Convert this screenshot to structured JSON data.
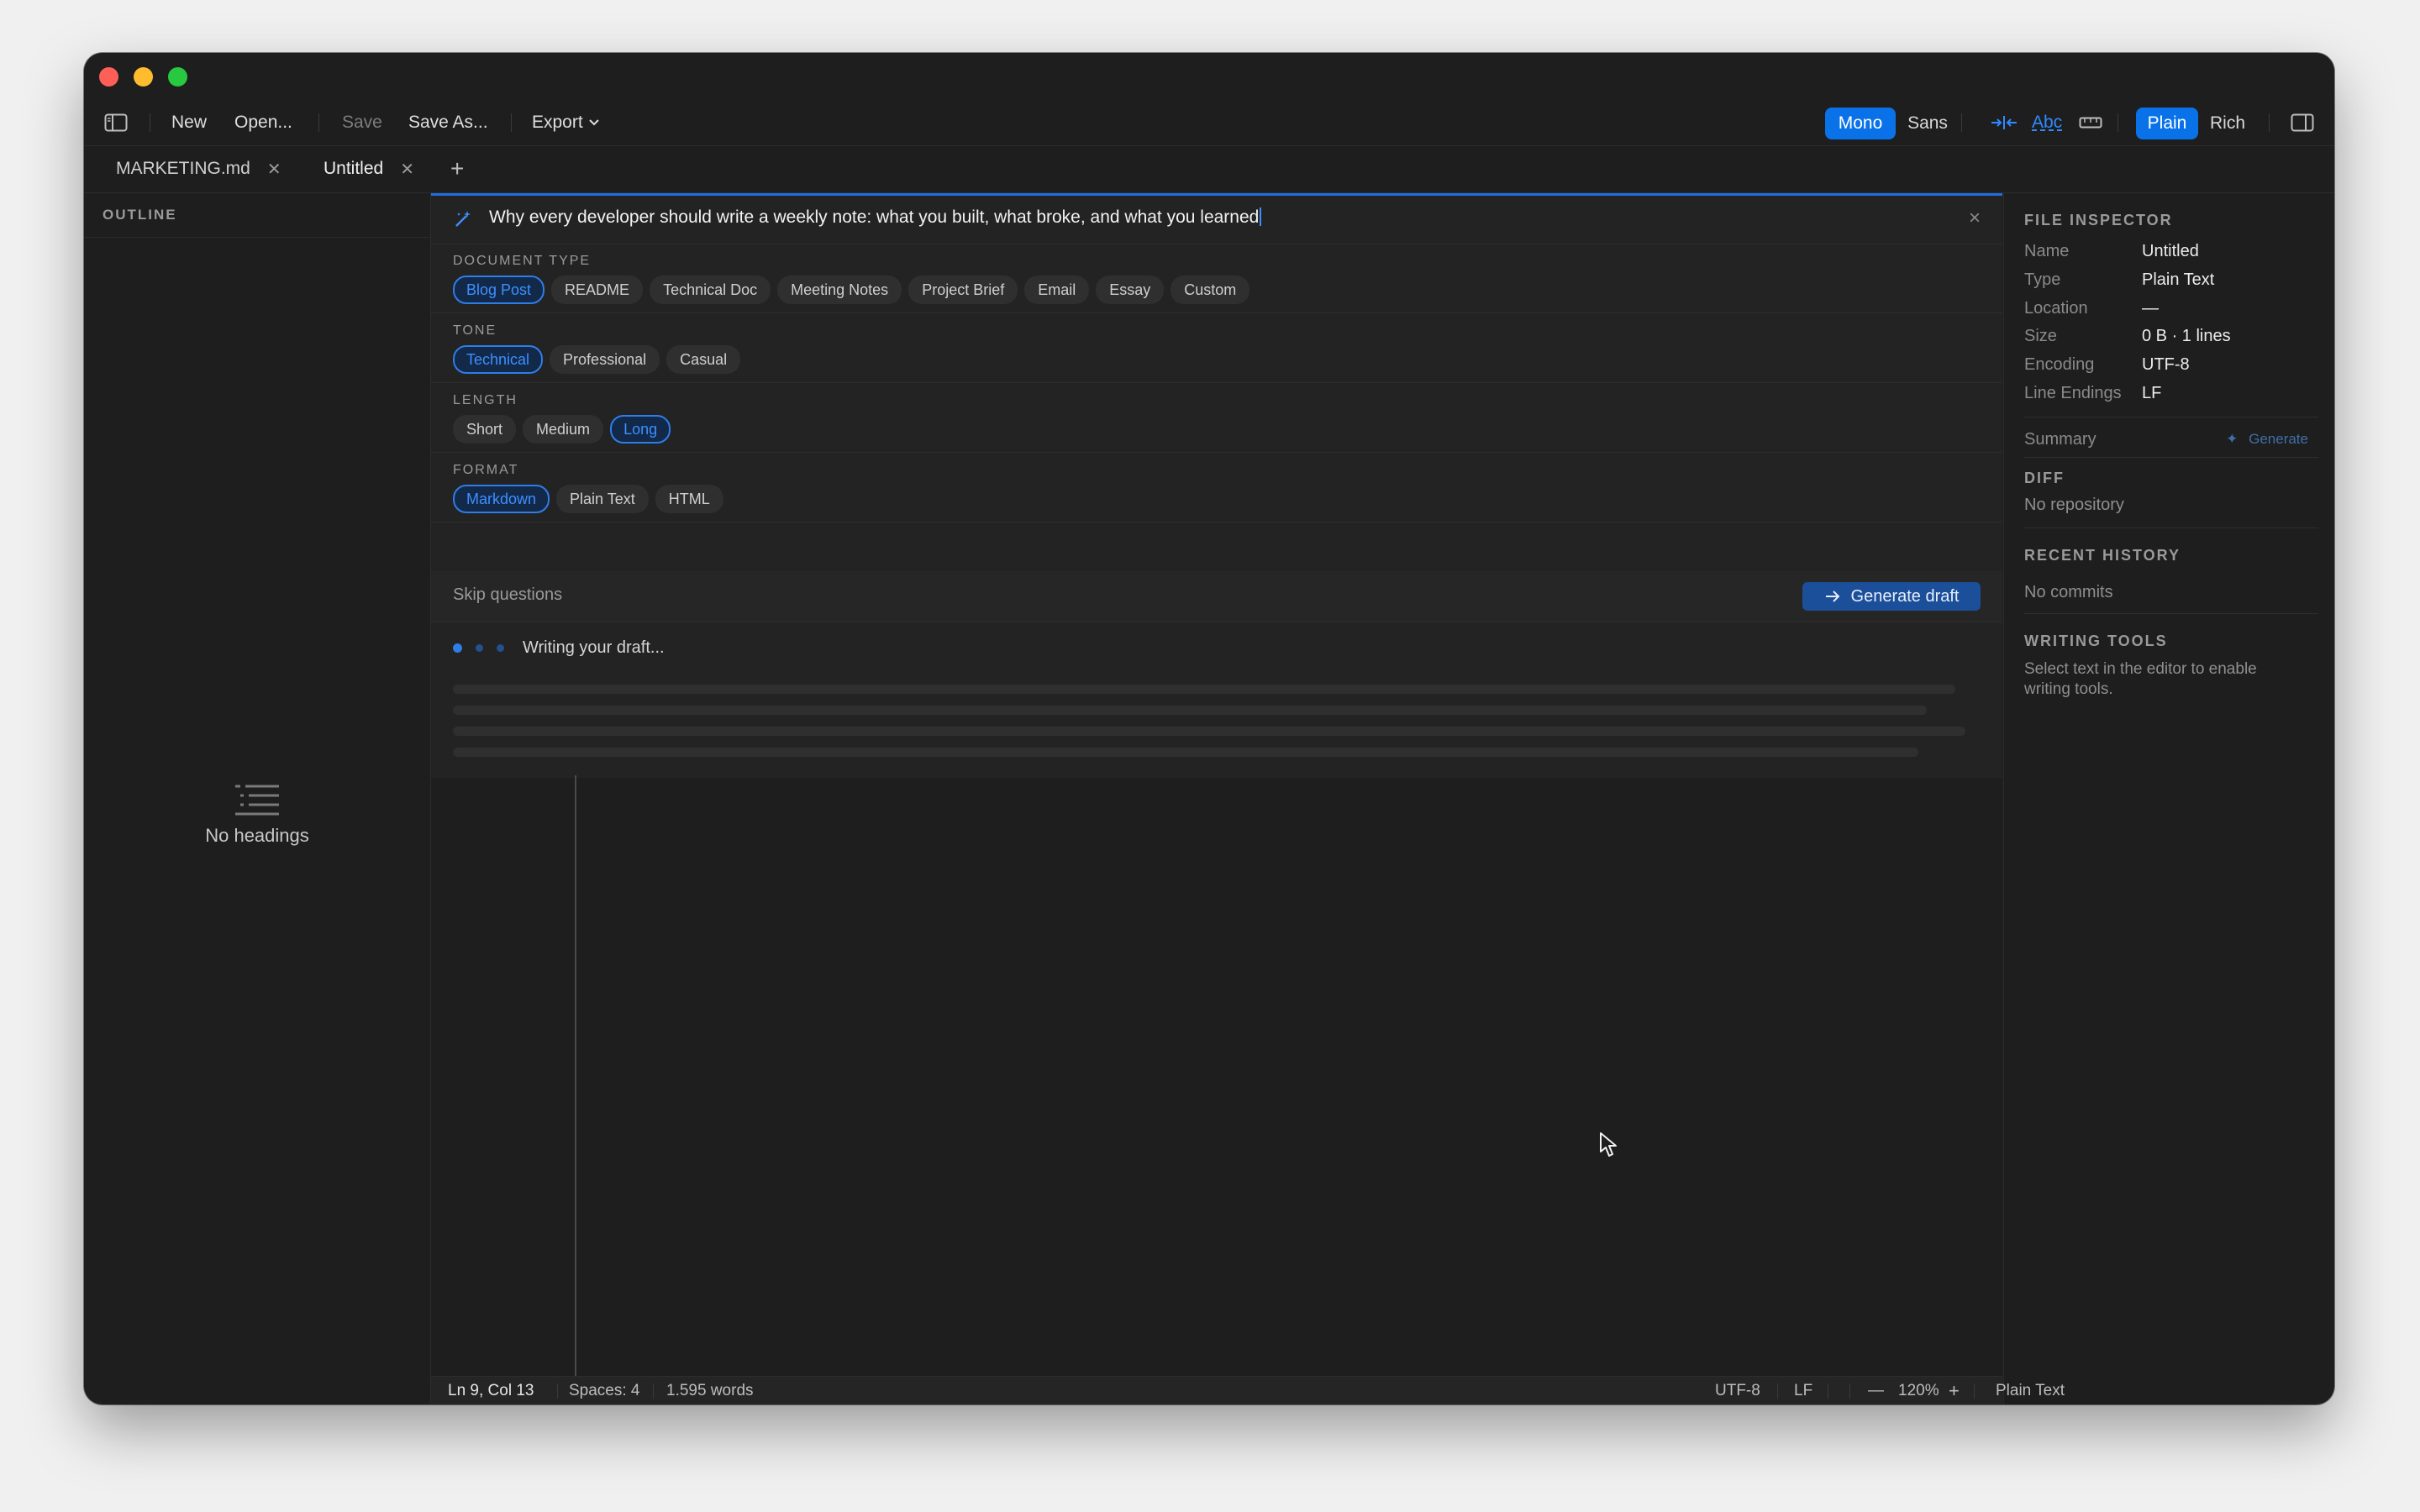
{
  "window": {
    "traffic_lights": [
      "close",
      "minimize",
      "zoom"
    ]
  },
  "toolbar": {
    "new": "New",
    "open": "Open...",
    "save": "Save",
    "save_as": "Save As...",
    "export": "Export",
    "font_mono": "Mono",
    "font_sans": "Sans",
    "spell_abc": "Abc",
    "mode_plain": "Plain",
    "mode_rich": "Rich",
    "accent_color": "#0a72e8"
  },
  "tabs": [
    {
      "label": "MARKETING.md",
      "active": false
    },
    {
      "label": "Untitled",
      "active": true
    }
  ],
  "tab_add": "+",
  "outline": {
    "heading": "OUTLINE",
    "empty_text": "No headings"
  },
  "draft": {
    "prompt": "Why every developer should write a weekly note: what you built, what broke, and what you learned",
    "close": "×",
    "document_type": {
      "label": "DOCUMENT TYPE",
      "options": [
        "Blog Post",
        "README",
        "Technical Doc",
        "Meeting Notes",
        "Project Brief",
        "Email",
        "Essay",
        "Custom"
      ],
      "selected": "Blog Post"
    },
    "tone": {
      "label": "TONE",
      "options": [
        "Technical",
        "Professional",
        "Casual"
      ],
      "selected": "Technical"
    },
    "length": {
      "label": "LENGTH",
      "options": [
        "Short",
        "Medium",
        "Long"
      ],
      "selected": "Long"
    },
    "format": {
      "label": "FORMAT",
      "options": [
        "Markdown",
        "Plain Text",
        "HTML"
      ],
      "selected": "Markdown"
    },
    "skip": "Skip questions",
    "generate": "Generate draft",
    "status": "Writing your draft..."
  },
  "inspector": {
    "file_heading": "FILE INSPECTOR",
    "fields": [
      {
        "key": "Name",
        "value": "Untitled"
      },
      {
        "key": "Type",
        "value": "Plain Text"
      },
      {
        "key": "Location",
        "value": "—"
      },
      {
        "key": "Size",
        "value": "0 B · 1 lines"
      },
      {
        "key": "Encoding",
        "value": "UTF-8"
      },
      {
        "key": "Line Endings",
        "value": "LF"
      }
    ],
    "summary_label": "Summary",
    "summary_action": "Generate",
    "diff_heading": "DIFF",
    "diff_text": "No repository",
    "history_heading": "RECENT HISTORY",
    "history_text": "No commits",
    "tools_heading": "WRITING TOOLS",
    "tools_text_1": "Select text in the editor to enable",
    "tools_text_2": "writing tools."
  },
  "status": {
    "position": "Ln 9, Col 13",
    "spaces": "Spaces: 4",
    "words": "1.595 words",
    "encoding": "UTF-8",
    "line_endings": "LF",
    "zoom_minus": "—",
    "zoom": "120%",
    "zoom_plus": "+",
    "mode": "Plain Text"
  }
}
